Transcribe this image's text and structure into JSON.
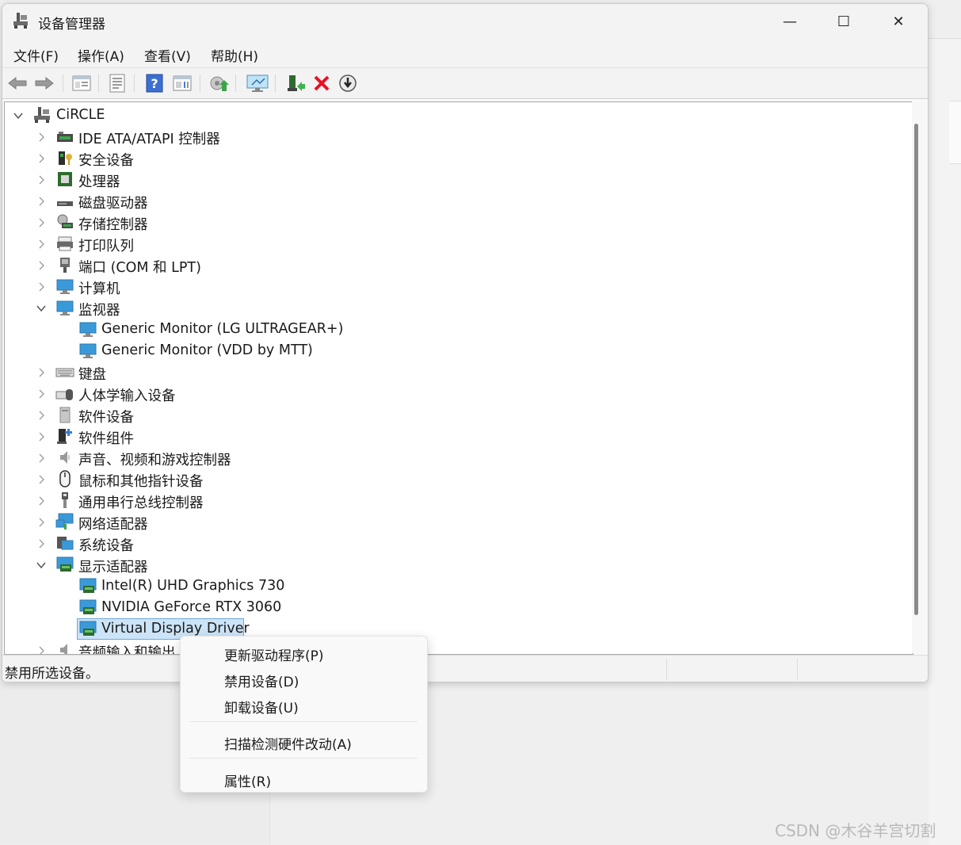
{
  "window": {
    "title": "设备管理器",
    "minimize_glyph": "—",
    "maximize_glyph": "☐",
    "close_glyph": "✕"
  },
  "menu": [
    "文件(F)",
    "操作(A)",
    "查看(V)",
    "帮助(H)"
  ],
  "toolbar": [
    "back-icon",
    "forward-icon",
    "show-hide-tree-icon",
    "properties-icon",
    "help-icon",
    "view-icon",
    "update-driver-icon",
    "scan-hardware-icon",
    "add-driver-icon",
    "uninstall-icon",
    "disable-icon"
  ],
  "tree": {
    "root": "CiRCLE",
    "items": [
      {
        "label": "IDE ATA/ATAPI 控制器",
        "icon": "ide-controller-icon",
        "expanded": false
      },
      {
        "label": "安全设备",
        "icon": "security-device-icon",
        "expanded": false
      },
      {
        "label": "处理器",
        "icon": "processor-icon",
        "expanded": false
      },
      {
        "label": "磁盘驱动器",
        "icon": "disk-drive-icon",
        "expanded": false
      },
      {
        "label": "存储控制器",
        "icon": "storage-controller-icon",
        "expanded": false
      },
      {
        "label": "打印队列",
        "icon": "printer-icon",
        "expanded": false
      },
      {
        "label": "端口 (COM 和 LPT)",
        "icon": "port-icon",
        "expanded": false
      },
      {
        "label": "计算机",
        "icon": "computer-icon",
        "expanded": false
      },
      {
        "label": "监视器",
        "icon": "monitor-icon",
        "expanded": true
      },
      {
        "label": "键盘",
        "icon": "keyboard-icon",
        "expanded": false
      },
      {
        "label": "人体学输入设备",
        "icon": "hid-icon",
        "expanded": false
      },
      {
        "label": "软件设备",
        "icon": "software-device-icon",
        "expanded": false
      },
      {
        "label": "软件组件",
        "icon": "software-component-icon",
        "expanded": false
      },
      {
        "label": "声音、视频和游戏控制器",
        "icon": "sound-icon",
        "expanded": false
      },
      {
        "label": "鼠标和其他指针设备",
        "icon": "mouse-icon",
        "expanded": false
      },
      {
        "label": "通用串行总线控制器",
        "icon": "usb-icon",
        "expanded": false
      },
      {
        "label": "网络适配器",
        "icon": "network-adapter-icon",
        "expanded": false
      },
      {
        "label": "系统设备",
        "icon": "system-device-icon",
        "expanded": false
      },
      {
        "label": "显示适配器",
        "icon": "display-adapter-icon",
        "expanded": true
      },
      {
        "label": "音频输入和输出",
        "icon": "audio-io-icon",
        "expanded": false
      }
    ],
    "monitors": [
      "Generic Monitor (LG ULTRAGEAR+)",
      "Generic Monitor (VDD by MTT)"
    ],
    "display_adapters": [
      "Intel(R) UHD Graphics 730",
      "NVIDIA GeForce RTX 3060",
      "Virtual Display Driver"
    ],
    "selected": "Virtual Display Driver"
  },
  "status": {
    "text": "禁用所选设备。"
  },
  "context_menu": {
    "items": [
      "更新驱动程序(P)",
      "禁用设备(D)",
      "卸载设备(U)",
      "扫描检测硬件改动(A)",
      "属性(R)"
    ]
  },
  "watermark": "CSDN @木谷羊宫切割",
  "colors": {
    "selection": "#cce4f7",
    "selection_border": "#6fa7d6",
    "uninstall_red": "#e81123",
    "monitor_blue": "#3a9ad9"
  }
}
